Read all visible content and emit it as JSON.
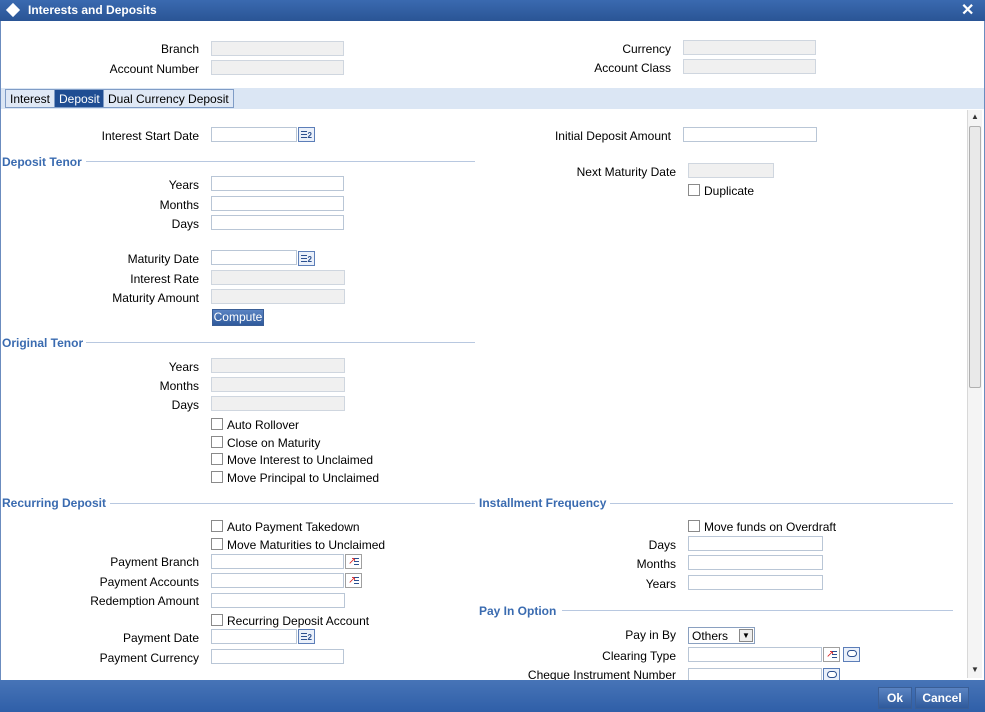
{
  "window": {
    "title": "Interests and Deposits",
    "close": "✕"
  },
  "header": {
    "branch_label": "Branch",
    "account_number_label": "Account Number",
    "currency_label": "Currency",
    "account_class_label": "Account Class"
  },
  "tabs": [
    {
      "label": "Interest",
      "active": false
    },
    {
      "label": "Deposit",
      "active": true
    },
    {
      "label": "Dual Currency Deposit",
      "active": false
    }
  ],
  "deposit": {
    "interest_start_date_label": "Interest Start Date",
    "initial_deposit_amount_label": "Initial Deposit Amount",
    "next_maturity_date_label": "Next Maturity Date",
    "duplicate_label": "Duplicate",
    "deposit_tenor": {
      "title": "Deposit Tenor",
      "years_label": "Years",
      "months_label": "Months",
      "days_label": "Days",
      "maturity_date_label": "Maturity Date",
      "interest_rate_label": "Interest Rate",
      "maturity_amount_label": "Maturity Amount",
      "compute_label": "Compute"
    },
    "original_tenor": {
      "title": "Original Tenor",
      "years_label": "Years",
      "months_label": "Months",
      "days_label": "Days",
      "auto_rollover_label": "Auto Rollover",
      "close_on_maturity_label": "Close on Maturity",
      "move_interest_label": "Move Interest to Unclaimed",
      "move_principal_label": "Move Principal to Unclaimed"
    },
    "recurring_deposit": {
      "title": "Recurring Deposit",
      "auto_payment_label": "Auto Payment Takedown",
      "move_maturities_label": "Move Maturities to Unclaimed",
      "payment_branch_label": "Payment Branch",
      "payment_accounts_label": "Payment Accounts",
      "redemption_amount_label": "Redemption Amount",
      "recurring_account_label": "Recurring Deposit Account",
      "payment_date_label": "Payment Date",
      "payment_currency_label": "Payment Currency"
    },
    "installment_frequency": {
      "title": "Installment Frequency",
      "move_funds_label": "Move funds on Overdraft",
      "days_label": "Days",
      "months_label": "Months",
      "years_label": "Years"
    },
    "pay_in_option": {
      "title": "Pay In Option",
      "pay_in_by_label": "Pay in By",
      "pay_in_by_value": "Others",
      "clearing_type_label": "Clearing Type",
      "cheque_label": "Cheque Instrument Number"
    }
  },
  "footer": {
    "ok_label": "Ok",
    "cancel_label": "Cancel"
  },
  "colors": {
    "accent": "#2f5fa8",
    "section": "#3a6bb0",
    "active_tab": "#1f4d93"
  }
}
